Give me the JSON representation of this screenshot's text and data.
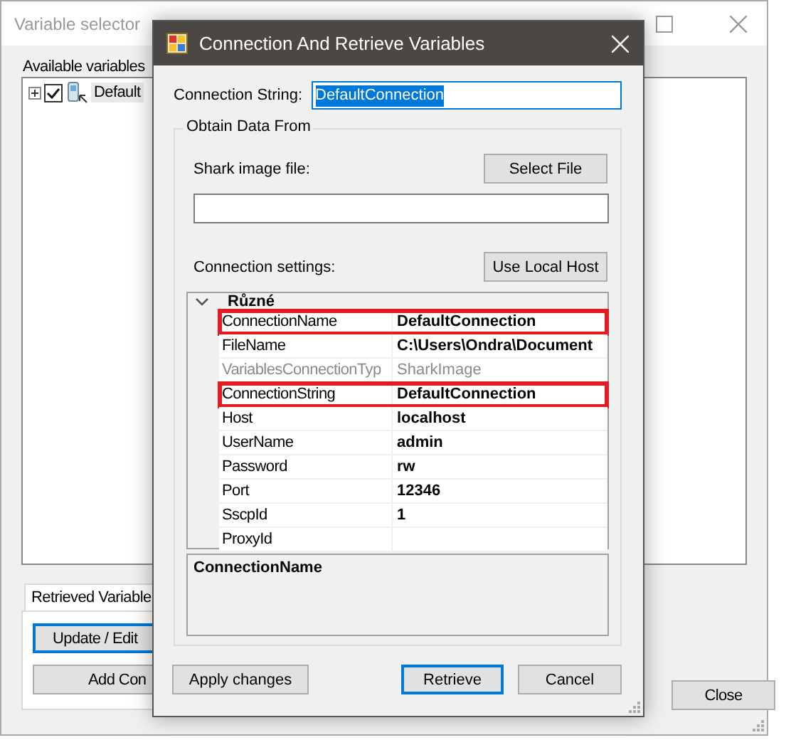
{
  "background_window": {
    "title": "Variable selector",
    "available_label": "Available variables",
    "tree": [
      {
        "label": "Default",
        "checked": true,
        "expanded": false
      }
    ],
    "tabs": [
      {
        "label": "Retrieved Variable",
        "selected": true
      }
    ],
    "buttons": [
      {
        "label": "Update / Edit",
        "focused": true
      },
      {
        "label": "Add Con",
        "focused": false
      }
    ],
    "close_button": "Close"
  },
  "dialog": {
    "title": "Connection And Retrieve Variables",
    "connection_string_label": "Connection String:",
    "connection_string_value": "DefaultConnection",
    "group_title": "Obtain Data From",
    "shark_file_label": "Shark image file:",
    "select_file_button": "Select File",
    "connection_settings_label": "Connection settings:",
    "use_local_host_button": "Use Local Host",
    "property_grid": {
      "category": "Různé",
      "expanded": true,
      "rows": [
        {
          "name": "ConnectionName",
          "value": "DefaultConnection",
          "disabled": false,
          "highlighted": true
        },
        {
          "name": "FileName",
          "value": "C:\\Users\\Ondra\\Document",
          "disabled": false,
          "highlighted": false
        },
        {
          "name": "VariablesConnectionTyp",
          "value": "SharkImage",
          "disabled": true,
          "highlighted": false
        },
        {
          "name": "ConnectionString",
          "value": "DefaultConnection",
          "disabled": false,
          "highlighted": true
        },
        {
          "name": "Host",
          "value": "localhost",
          "disabled": false,
          "highlighted": false
        },
        {
          "name": "UserName",
          "value": "admin",
          "disabled": false,
          "highlighted": false
        },
        {
          "name": "Password",
          "value": "rw",
          "disabled": false,
          "highlighted": false
        },
        {
          "name": "Port",
          "value": "12346",
          "disabled": false,
          "highlighted": false
        },
        {
          "name": "SscpId",
          "value": "1",
          "disabled": false,
          "highlighted": false
        },
        {
          "name": "ProxyId",
          "disabled": false,
          "highlighted": false
        }
      ],
      "description_title": "ConnectionName"
    },
    "buttons": [
      {
        "label": "Apply changes",
        "focused": false
      },
      {
        "label": "Retrieve",
        "focused": true
      },
      {
        "label": "Cancel",
        "focused": false
      }
    ]
  }
}
